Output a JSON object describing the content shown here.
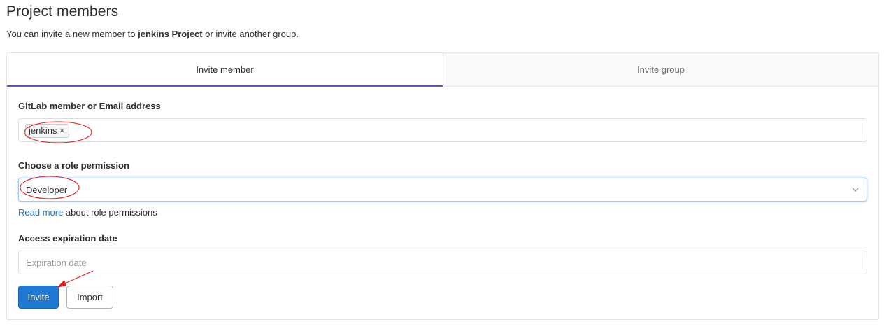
{
  "header": {
    "title": "Project members",
    "subtitle_prefix": "You can invite a new member to ",
    "project_name": "jenkins Project",
    "subtitle_suffix": " or invite another group."
  },
  "tabs": [
    {
      "label": "Invite member",
      "active": true
    },
    {
      "label": "Invite group",
      "active": false
    }
  ],
  "member_field": {
    "label": "GitLab member or Email address",
    "token": "jenkins",
    "token_remove_glyph": "×"
  },
  "role_field": {
    "label": "Choose a role permission",
    "selected": "Developer",
    "help_link": "Read more",
    "help_text": " about role permissions"
  },
  "expiration_field": {
    "label": "Access expiration date",
    "placeholder": "Expiration date"
  },
  "buttons": {
    "invite": "Invite",
    "import": "Import"
  },
  "colors": {
    "accent_tab": "#6b4fbb",
    "primary_button": "#1f78d1",
    "annotation_red": "#e02020"
  },
  "icons": {
    "select_chevron": "chevron-down-icon",
    "token_remove": "close-icon"
  }
}
